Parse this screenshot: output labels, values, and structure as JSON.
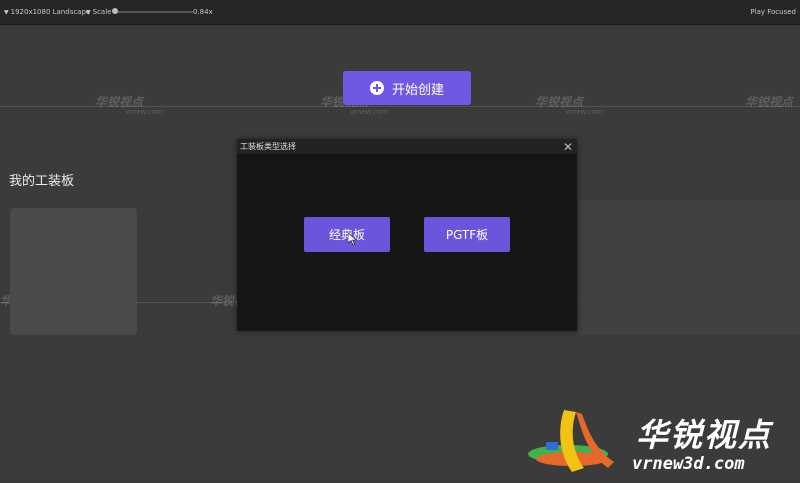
{
  "toolbar": {
    "resolution": "1920x1080 Landscape",
    "scale_label": "Scale",
    "zoom": "0.84x",
    "play_mode": "Play Focused"
  },
  "main": {
    "start_button": "开始创建",
    "section_title": "我的工装板"
  },
  "dialog": {
    "title": "工装板类型选择",
    "close": "✕",
    "options": [
      "经典板",
      "PGTF板"
    ]
  },
  "watermark": {
    "text": "华锐视点",
    "sub": "vrnew.com"
  },
  "logo": {
    "text": "华锐视点",
    "sub": "vrnew3d.com"
  },
  "colors": {
    "accent": "#7158e2",
    "modal_bg": "#161616",
    "view_bg": "#3b3b3b"
  }
}
